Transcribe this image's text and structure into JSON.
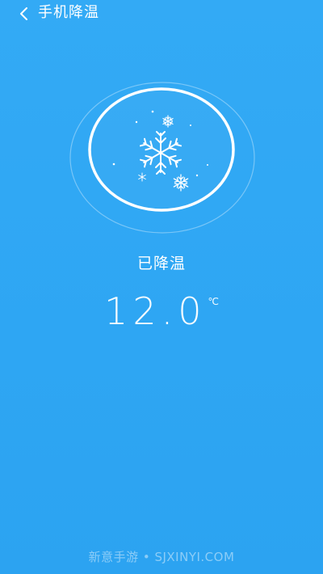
{
  "header": {
    "title": "手机降温",
    "back_icon": "chevron-left-icon"
  },
  "cooling": {
    "status_text": "已降温",
    "temperature": "12.0",
    "unit": "℃",
    "icon": "snowflake-icon"
  },
  "watermark": {
    "text": "新意手游 • SJXINYI.COM"
  },
  "colors": {
    "background": "#2ea7f4",
    "foreground": "#ffffff"
  }
}
